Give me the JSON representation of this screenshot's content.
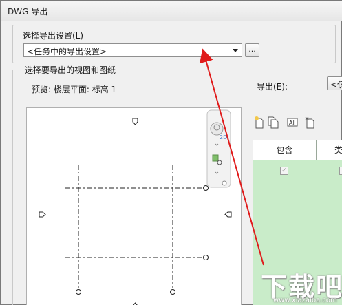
{
  "window": {
    "title": "DWG 导出"
  },
  "setup": {
    "label": "选择导出设置(L)",
    "combo_value": "<任务中的导出设置>",
    "browse_label": "..."
  },
  "views": {
    "label": "选择要导出的视图和图纸",
    "preview_label": "预览:  楼层平面: 标高 1"
  },
  "export": {
    "label": "导出(E):",
    "combo_value": "<仅"
  },
  "table": {
    "columns": [
      "包含",
      "类"
    ],
    "rows": [
      {
        "include": "✓"
      }
    ]
  },
  "watermark": {
    "text": "下载吧",
    "subtext": "www.xiazaiba.com"
  },
  "icons": [
    "new-set-icon",
    "duplicate-set-icon",
    "rename-set-icon",
    "delete-set-icon",
    "view-cube-icon",
    "zoom-icon",
    "arrow-annotation-icon"
  ],
  "colors": {
    "grid_bg": "#c9ecc9",
    "annotation": "#e01b1b"
  }
}
